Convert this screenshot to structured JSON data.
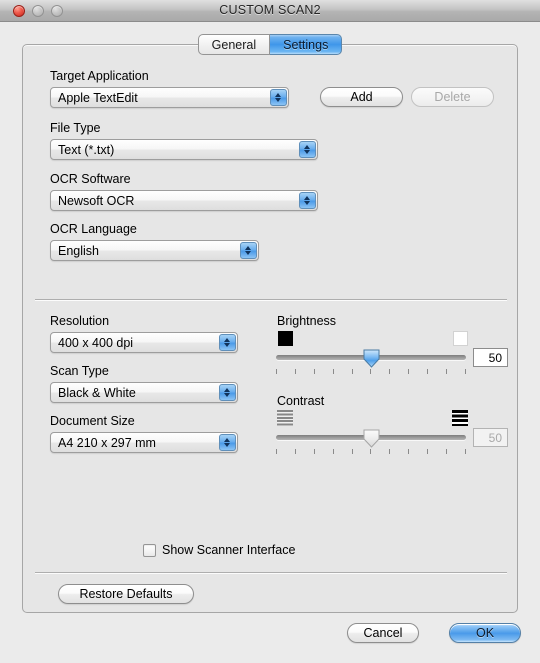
{
  "window": {
    "title": "CUSTOM SCAN2",
    "close_button": "close",
    "minimize_button": "minimize",
    "zoom_button": "zoom"
  },
  "tabs": [
    {
      "label": "General",
      "selected": false
    },
    {
      "label": "Settings",
      "selected": true
    }
  ],
  "fields": {
    "target_application": {
      "label": "Target Application",
      "value": "Apple TextEdit"
    },
    "file_type": {
      "label": "File Type",
      "value": "Text (*.txt)"
    },
    "ocr_software": {
      "label": "OCR Software",
      "value": "Newsoft OCR"
    },
    "ocr_language": {
      "label": "OCR Language",
      "value": "English"
    },
    "resolution": {
      "label": "Resolution",
      "value": "400 x 400 dpi"
    },
    "scan_type": {
      "label": "Scan Type",
      "value": "Black & White"
    },
    "document_size": {
      "label": "Document Size",
      "value": "A4  210 x 297 mm"
    }
  },
  "buttons": {
    "add": {
      "label": "Add",
      "enabled": true
    },
    "delete": {
      "label": "Delete",
      "enabled": false
    },
    "restore_defaults": {
      "label": "Restore Defaults",
      "enabled": true
    },
    "cancel": {
      "label": "Cancel",
      "enabled": true
    },
    "ok": {
      "label": "OK",
      "enabled": true,
      "default": true
    }
  },
  "sliders": {
    "brightness": {
      "label": "Brightness",
      "value": "50",
      "position_percent": 50,
      "enabled": true,
      "tick_count": 11,
      "min_icon": "black-swatch",
      "max_icon": "white-swatch"
    },
    "contrast": {
      "label": "Contrast",
      "value": "50",
      "position_percent": 50,
      "enabled": false,
      "tick_count": 11,
      "min_icon": "low-contrast-icon",
      "max_icon": "high-contrast-icon"
    }
  },
  "checkbox": {
    "label": "Show Scanner Interface",
    "checked": false
  },
  "colors": {
    "accent": "#4a9ae9",
    "window_bg": "#ebebeb",
    "panel_bg": "#e6e6e6",
    "close_red": "#c9251a"
  }
}
